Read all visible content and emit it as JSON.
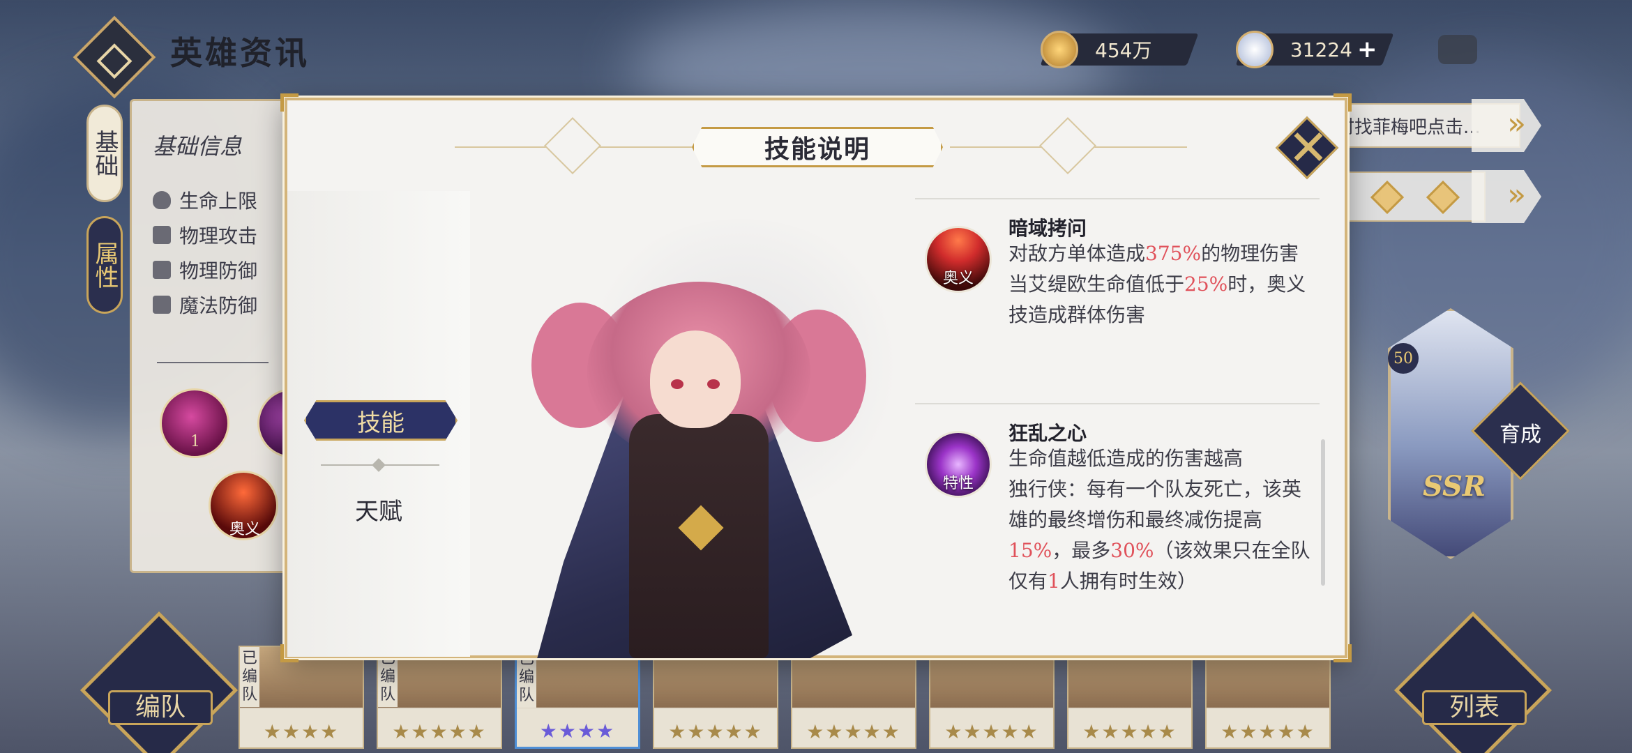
{
  "header": {
    "title": "英雄资讯",
    "gold": "454万",
    "gems": "31224",
    "plus": "+"
  },
  "side_tabs": {
    "basic": "基础",
    "attributes": "属性"
  },
  "info_panel": {
    "title": "基础信息",
    "attributes": [
      "生命上限",
      "物理攻击",
      "物理防御",
      "魔法防御"
    ],
    "orb_number": "1",
    "orb_tag": "奥义"
  },
  "right_panel": {
    "hint": "时找菲梅吧点击...",
    "hero_level": "50",
    "rarity": "SSR",
    "grow_label": "育成"
  },
  "bottom": {
    "team_label": "编队",
    "list_label": "列表",
    "slot_tag": "已编队",
    "slots": [
      {
        "stars": "★★★★"
      },
      {
        "stars": "★★★★★"
      },
      {
        "stars": "★★★★"
      },
      {
        "stars": "★★★★★"
      },
      {
        "stars": "★★★★★"
      },
      {
        "stars": "★★★★★"
      },
      {
        "stars": "★★★★★"
      },
      {
        "stars": "★★★★★"
      }
    ]
  },
  "modal": {
    "title": "技能说明",
    "tabs": {
      "skill": "技能",
      "talent": "天赋"
    },
    "skills": [
      {
        "icon_tag": "奥义",
        "name": "暗域拷问",
        "desc_parts": [
          {
            "t": "对敌方单体造成",
            "hl": false
          },
          {
            "t": "375%",
            "hl": true
          },
          {
            "t": "的物理伤害",
            "hl": false
          },
          {
            "t": "当艾缇欧生命值低于",
            "hl": false
          },
          {
            "t": "25%",
            "hl": true
          },
          {
            "t": "时，奥义技造成群体伤害",
            "hl": false
          }
        ]
      },
      {
        "icon_tag": "特性",
        "name": "狂乱之心",
        "desc_parts": [
          {
            "t": "生命值越低造成的伤害越高",
            "hl": false
          },
          {
            "t": "独行侠：每有一个队友死亡，该英雄的最终增伤和最终减伤提高",
            "hl": false
          },
          {
            "t": "15%",
            "hl": true
          },
          {
            "t": "，最多",
            "hl": false
          },
          {
            "t": "30%",
            "hl": true
          },
          {
            "t": "（该效果只在全队仅有",
            "hl": false
          },
          {
            "t": "1",
            "hl": true
          },
          {
            "t": "人拥有时生效）",
            "hl": false
          }
        ]
      }
    ]
  },
  "colors": {
    "accent_gold": "#c9a55a",
    "navy": "#2c3266",
    "highlight_red": "#e0515a"
  }
}
